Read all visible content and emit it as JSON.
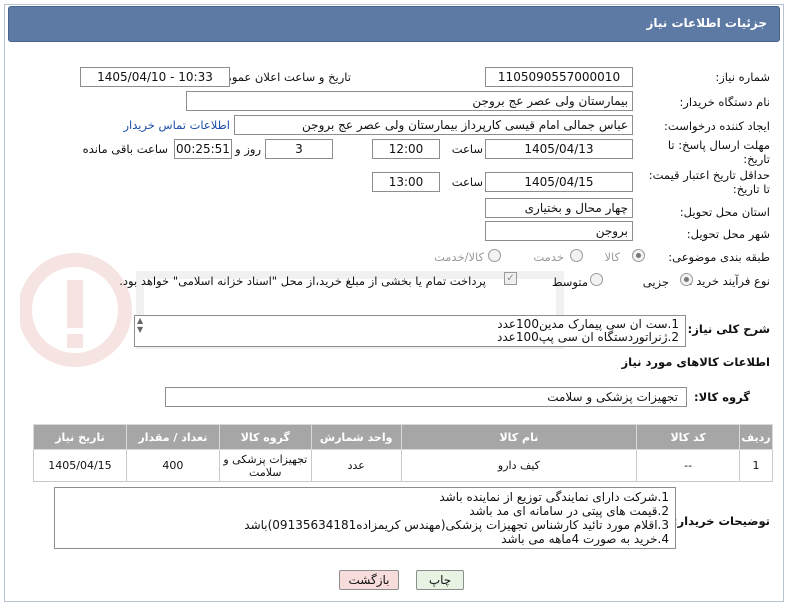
{
  "header": {
    "title": "جزئیات اطلاعات نیاز"
  },
  "form": {
    "need_number_label": "شماره نیاز:",
    "need_number": "1105090557000010",
    "announce_label": "تاریخ و ساعت اعلان عمومی:",
    "announce_value": "1405/04/10 - 10:33",
    "buyer_org_label": "نام دستگاه خریدار:",
    "buyer_org": "بیمارستان ولی عصر  عج  بروجن",
    "requester_label": "ایجاد کننده درخواست:",
    "requester": "عباس جمالی امام قیسی کارپرداز بیمارستان ولی عصر  عج  بروجن",
    "contact_link": "اطلاعات تماس خریدار",
    "deadline_label_1": "مهلت ارسال پاسخ: تا",
    "deadline_label_2": "تاریخ:",
    "deadline_date": "1405/04/13",
    "time_label": "ساعت",
    "deadline_time": "12:00",
    "days_value": "3",
    "days_label": "روز و",
    "remaining_time": "00:25:51",
    "remaining_label": "ساعت باقی مانده",
    "validity_label_1": "حداقل تاریخ اعتبار قیمت:",
    "validity_label_2": "تا تاریخ:",
    "validity_date": "1405/04/15",
    "validity_time": "13:00",
    "province_label": "استان محل تحویل:",
    "province": "چهار محال و بختیاری",
    "city_label": "شهر محل تحویل:",
    "city": "بروجن",
    "category_label": "طبقه بندی موضوعی:",
    "category_options": [
      "کالا",
      "خدمت",
      "کالا/خدمت"
    ],
    "process_label": "نوع فرآیند خرید :",
    "process_options": [
      "جزیی",
      "متوسط"
    ],
    "payment_note": "پرداخت تمام یا بخشی از مبلغ خرید،از محل \"اسناد خزانه اسلامی\" خواهد بود."
  },
  "summary": {
    "label": "شرح کلی نیاز:",
    "lines": [
      "1.ست ان سی پیمارک مدین100عدد",
      "2.ژنراتوردستگاه ان سی پپ100عدد"
    ]
  },
  "goods": {
    "section_title": "اطلاعات کالاهای مورد نیاز",
    "group_label": "گروه کالا:",
    "group_value": "تجهیزات پزشکی و سلامت",
    "columns": [
      "ردیف",
      "کد کالا",
      "نام کالا",
      "واحد شمارش",
      "گروه کالا",
      "تعداد / مقدار",
      "تاریخ نیاز"
    ],
    "rows": [
      {
        "row": "1",
        "code": "--",
        "name": "کیف دارو",
        "unit": "عدد",
        "group": "تجهیزات پزشکی و سلامت",
        "qty": "400",
        "date": "1405/04/15"
      }
    ]
  },
  "buyer_notes": {
    "label": "توضیحات خریدار:",
    "lines": [
      "1.شرکت دارای نمایندگی توزیع از نماینده باشد",
      "2.قیمت های پیتی در سامانه ای مد باشد",
      "3.اقلام مورد تائید کارشناس تجهیزات پزشکی(مهندس کریمزاده09135634181)باشد",
      "4.خرید به صورت 4ماهه می باشد"
    ]
  },
  "buttons": {
    "print": "چاپ",
    "back": "بازگشت"
  },
  "colors": {
    "header": "#5c7aa3",
    "table_header": "#a6a6a6",
    "back_button": "#f7dcdc",
    "print_button": "#e8f3e4"
  }
}
